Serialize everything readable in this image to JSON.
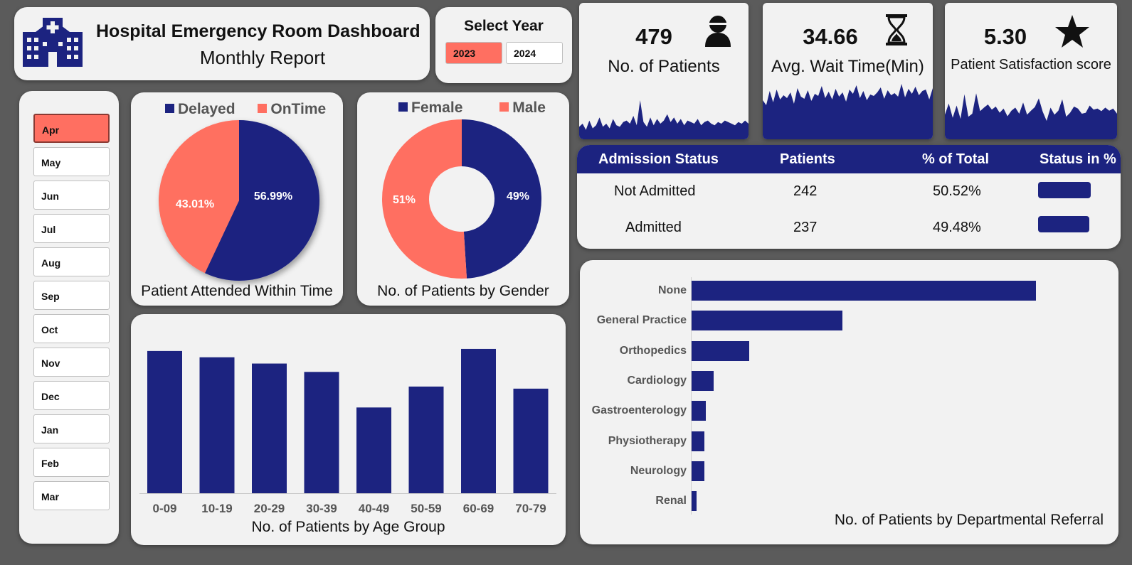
{
  "header": {
    "title": "Hospital Emergency Room Dashboard",
    "subtitle": "Monthly Report",
    "logo_icon": "hospital-icon"
  },
  "year_selector": {
    "label": "Select Year",
    "options": [
      "2023",
      "2024"
    ],
    "selected": "2023"
  },
  "kpis": [
    {
      "value": "479",
      "label": "No. of Patients",
      "icon": "patient-icon"
    },
    {
      "value": "34.66",
      "label": "Avg. Wait Time(Min)",
      "icon": "hourglass-icon"
    },
    {
      "value": "5.30",
      "label": "Patient Satisfaction score",
      "icon": "star-icon"
    }
  ],
  "months": {
    "items": [
      "Apr",
      "May",
      "Jun",
      "Jul",
      "Aug",
      "Sep",
      "Oct",
      "Nov",
      "Dec",
      "Jan",
      "Feb",
      "Mar"
    ],
    "selected": "Apr"
  },
  "colors": {
    "navy": "#1c2380",
    "coral": "#ff6f61",
    "card": "#f2f2f2",
    "background": "#5b5b5b"
  },
  "admission": {
    "headers": [
      "Admission Status",
      "Patients",
      "%  of Total",
      "Status in %"
    ],
    "rows": [
      {
        "status": "Not Admitted",
        "patients": "242",
        "pct": "50.52%",
        "pct_value": 50.52
      },
      {
        "status": "Admitted",
        "patients": "237",
        "pct": "49.48%",
        "pct_value": 49.48
      }
    ]
  },
  "chart_data": [
    {
      "type": "pie",
      "title": "Patient Attended Within Time",
      "labels": [
        "Delayed",
        "OnTime"
      ],
      "values": [
        56.99,
        43.01
      ],
      "value_labels": [
        "56.99%",
        "43.01%"
      ],
      "colors": [
        "#1c2380",
        "#ff6f61"
      ],
      "legend": "top"
    },
    {
      "type": "pie",
      "variant": "donut",
      "title": "No. of Patients by Gender",
      "labels": [
        "Female",
        "Male"
      ],
      "values": [
        49,
        51
      ],
      "value_labels": [
        "49%",
        "51%"
      ],
      "colors": [
        "#1c2380",
        "#ff6f61"
      ],
      "legend": "top"
    },
    {
      "type": "bar",
      "title": "No. of Patients by Age Group",
      "categories": [
        "0-09",
        "10-19",
        "20-29",
        "30-39",
        "40-49",
        "50-59",
        "60-69",
        "70-79"
      ],
      "values": [
        68,
        65,
        62,
        58,
        41,
        51,
        69,
        50
      ],
      "grid": false
    },
    {
      "type": "bar",
      "orientation": "horizontal",
      "title": "No. of Patients by Departmental Referral",
      "categories": [
        "None",
        "General Practice",
        "Orthopedics",
        "Cardiology",
        "Gastroenterology",
        "Physiotherapy",
        "Neurology",
        "Renal"
      ],
      "values": [
        263,
        115,
        44,
        17,
        11,
        10,
        10,
        4
      ],
      "grid": false
    }
  ],
  "sparklines": {
    "patients": [
      8,
      10,
      6,
      12,
      7,
      9,
      14,
      8,
      10,
      7,
      13,
      9,
      8,
      11,
      12,
      10,
      15,
      9,
      25,
      11,
      8,
      14,
      9,
      13,
      10,
      12,
      16,
      11,
      14,
      10,
      13,
      9,
      12,
      11,
      10,
      13,
      9,
      11,
      12,
      10,
      9,
      11,
      10,
      12,
      11,
      10,
      9,
      11,
      10,
      12,
      10
    ],
    "wait_time": [
      55,
      48,
      68,
      52,
      70,
      56,
      62,
      58,
      66,
      50,
      72,
      60,
      57,
      69,
      54,
      64,
      61,
      75,
      58,
      67,
      56,
      71,
      60,
      66,
      53,
      70,
      64,
      76,
      58,
      68,
      55,
      63,
      61,
      66,
      73,
      57,
      69,
      62,
      65,
      60,
      78,
      59,
      71,
      64,
      74,
      62,
      68,
      70,
      56,
      72
    ],
    "satisfaction": [
      48,
      70,
      42,
      66,
      40,
      88,
      44,
      50,
      90,
      55,
      62,
      68,
      58,
      64,
      52,
      60,
      45,
      56,
      62,
      50,
      72,
      48,
      56,
      63,
      80,
      54,
      36,
      62,
      48,
      56,
      78,
      44,
      52,
      64,
      60,
      50,
      52,
      66,
      58,
      60,
      55,
      62,
      56,
      60,
      50
    ]
  }
}
